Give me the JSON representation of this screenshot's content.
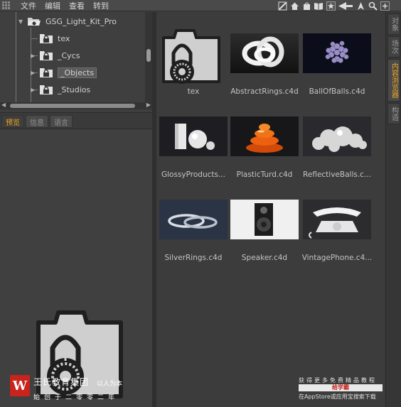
{
  "menu": {
    "items": [
      "文件",
      "编辑",
      "查看",
      "转到"
    ]
  },
  "toolbar": {
    "icons": [
      "edit-icon",
      "home-icon",
      "bag-icon",
      "book-icon",
      "star-icon",
      "back-arrow-icon",
      "cursor-icon",
      "search-icon",
      "add-icon"
    ]
  },
  "tree": {
    "root": "GSG_Light_Kit_Pro",
    "children": [
      "tex",
      "_Cycs",
      "_Objects",
      "_Studios"
    ],
    "selected": "_Objects"
  },
  "preview_tabs": [
    "预览",
    "信息",
    "语言"
  ],
  "browser": {
    "items": [
      {
        "name": "tex",
        "kind": "folder"
      },
      {
        "name": "AbstractRings.c4d",
        "kind": "rings"
      },
      {
        "name": "BallOfBalls.c4d",
        "kind": "ballofballs"
      },
      {
        "name": "GlossyProducts...",
        "kind": "glossy"
      },
      {
        "name": "PlasticTurd.c4d",
        "kind": "turd"
      },
      {
        "name": "ReflectiveBalls.c...",
        "kind": "reflective"
      },
      {
        "name": "SilverRings.c4d",
        "kind": "silverrings"
      },
      {
        "name": "Speaker.c4d",
        "kind": "speaker"
      },
      {
        "name": "VintagePhone.c4...",
        "kind": "phone"
      }
    ]
  },
  "right_tabs": [
    "对象",
    "场次",
    "内容浏览器",
    "构造"
  ],
  "right_tabs_active": "内容浏览器",
  "watermark": {
    "logo_letter": "W",
    "company": "王氏教育集团",
    "slogan": "以人为本",
    "founded": "始创于二零零二年",
    "right_line1": "获得更多免费精品教程",
    "right_line2": "给学霸",
    "right_line3": "在AppStore或应用宝搜索下载"
  },
  "colors": {
    "accent": "#f0a820",
    "background": "#3e3e3e",
    "brand_red": "#c8231c"
  }
}
